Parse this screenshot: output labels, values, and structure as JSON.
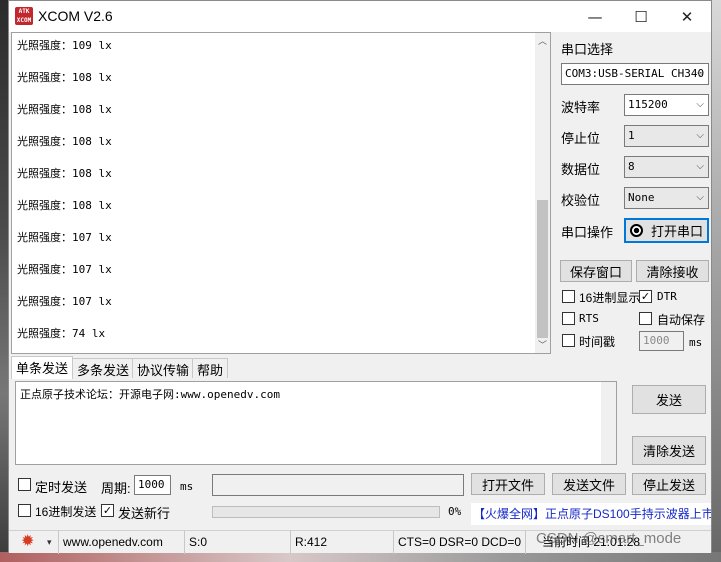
{
  "window": {
    "title": "XCOM V2.6",
    "icon_text": "ATK XCOM",
    "controls": {
      "minimize": "—",
      "maximize": "☐",
      "close": "✕"
    }
  },
  "receive": {
    "lines": [
      "光照强度：109 lx",
      "光照强度：108 lx",
      "光照强度：108 lx",
      "光照强度：108 lx",
      "光照强度：108 lx",
      "光照强度：108 lx",
      "光照强度：107 lx",
      "光照强度：107 lx",
      "光照强度：107 lx",
      "光照强度：74 lx"
    ]
  },
  "panel": {
    "port_select_label": "串口选择",
    "port_value": "COM3:USB-SERIAL CH340",
    "baud_label": "波特率",
    "baud_value": "115200",
    "stop_label": "停止位",
    "stop_value": "1",
    "data_label": "数据位",
    "data_value": "8",
    "parity_label": "校验位",
    "parity_value": "None",
    "op_label": "串口操作",
    "open_button": "打开串口",
    "save_window": "保存窗口",
    "clear_recv": "清除接收",
    "hex_display": "16进制显示",
    "dtr": "DTR",
    "rts": "RTS",
    "auto_save": "自动保存",
    "timestamp": "时间戳",
    "timestamp_value": "1000",
    "timestamp_unit": "ms"
  },
  "tabs": [
    "单条发送",
    "多条发送",
    "协议传输",
    "帮助"
  ],
  "send": {
    "text": "正点原子技术论坛：开源电子网:www.openedv.com",
    "send_button": "发送",
    "clear_send": "清除发送",
    "timed_send": "定时发送",
    "period_label": "周期:",
    "period_value": "1000",
    "period_unit": "ms",
    "open_file": "打开文件",
    "send_file": "发送文件",
    "stop_send": "停止发送",
    "hex_send": "16进制发送",
    "send_newline": "发送新行",
    "progress": "0%",
    "progress_fraction": 0,
    "promo": "【火爆全网】正点原子DS100手持示波器上市"
  },
  "status": {
    "url": "www.openedv.com",
    "s": "S:0",
    "r": "R:412",
    "signals": "CTS=0 DSR=0 DCD=0",
    "time": "当前时间 21:01:28",
    "watermark": "CSDN @smart_mode"
  }
}
